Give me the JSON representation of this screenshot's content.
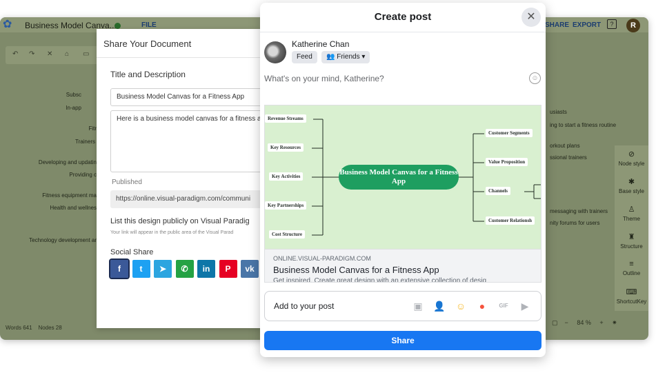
{
  "app": {
    "title": "Business Model Canva...",
    "menu_file": "FILE",
    "menu_share": "SHARE",
    "menu_export": "EXPORT",
    "user_initial": "R",
    "status_words": "Words 641",
    "status_nodes": "Nodes 28",
    "zoom": "84 %",
    "canvas_left": [
      "Subsc",
      "In-app",
      "Fitr",
      "Trainers",
      "Developing and updatin",
      "Providing c",
      "Fitness equipment ma",
      "Health and wellnes",
      "Technology development ar"
    ],
    "canvas_right": [
      "usiasts",
      "ing to start a fitness routine",
      "orkout plans",
      "ssional trainers",
      "messaging with trainers",
      "nity forums for users"
    ],
    "right_panel": [
      {
        "label": "Node style",
        "icon": "node-style-icon"
      },
      {
        "label": "Base style",
        "icon": "base-style-icon"
      },
      {
        "label": "Theme",
        "icon": "theme-icon"
      },
      {
        "label": "Structure",
        "icon": "structure-icon"
      },
      {
        "label": "Outline",
        "icon": "outline-icon"
      },
      {
        "label": "ShortcutKey",
        "icon": "keyboard-icon"
      }
    ]
  },
  "share_dialog": {
    "title": "Share Your Document",
    "section_title": "Title and Description",
    "title_value": "Business Model Canvas for a Fitness App",
    "description_value": "Here is a business model canvas for a fitness a",
    "published_label": "Published",
    "published_url": "https://online.visual-paradigm.com/communi",
    "public_title": "List this design publicly on Visual Paradig",
    "public_sub": "Your link will appear in the public area of the Visual Parad",
    "social_label": "Social Share",
    "social_buttons": [
      {
        "name": "facebook",
        "glyph": "f",
        "color": "#3b5998"
      },
      {
        "name": "twitter",
        "glyph": "t",
        "color": "#1da1f2"
      },
      {
        "name": "telegram",
        "glyph": "➤",
        "color": "#2ca5e0"
      },
      {
        "name": "whatsapp",
        "glyph": "✆",
        "color": "#25a244"
      },
      {
        "name": "linkedin",
        "glyph": "in",
        "color": "#0e76a8"
      },
      {
        "name": "pinterest",
        "glyph": "P",
        "color": "#e60023"
      },
      {
        "name": "vk",
        "glyph": "vk",
        "color": "#4a76a8"
      }
    ]
  },
  "fb_post": {
    "title": "Create post",
    "user_name": "Katherine Chan",
    "audience_feed": "Feed",
    "audience_friends": "Friends",
    "placeholder": "What's on your mind, Katherine?",
    "preview": {
      "domain": "ONLINE.VISUAL-PARADIGM.COM",
      "title": "Business Model Canvas for a Fitness App",
      "description": "Get inspired. Create great design with an extensive collection of desig",
      "mindmap": {
        "center": "Business Model Canvas for a Fitness App",
        "left": [
          "Revenue Streams",
          "Key Resources",
          "Key Activities",
          "Key Partnerships",
          "Cost Structure"
        ],
        "right": [
          "Customer Segments",
          "Value Proposition",
          "Channels",
          "Customer Relationsh"
        ]
      }
    },
    "add_label": "Add to your post",
    "add_icons": [
      {
        "name": "photo-icon",
        "glyph": "▣",
        "color": "#b0b3b8"
      },
      {
        "name": "tag-people-icon",
        "glyph": "👤",
        "color": "#1877f2"
      },
      {
        "name": "feeling-icon",
        "glyph": "☺",
        "color": "#f7b928"
      },
      {
        "name": "location-icon",
        "glyph": "●",
        "color": "#f5533d"
      },
      {
        "name": "gif-icon",
        "glyph": "GIF",
        "color": "#b0b3b8"
      },
      {
        "name": "live-video-icon",
        "glyph": "▶",
        "color": "#b0b3b8"
      }
    ],
    "share_button": "Share"
  }
}
